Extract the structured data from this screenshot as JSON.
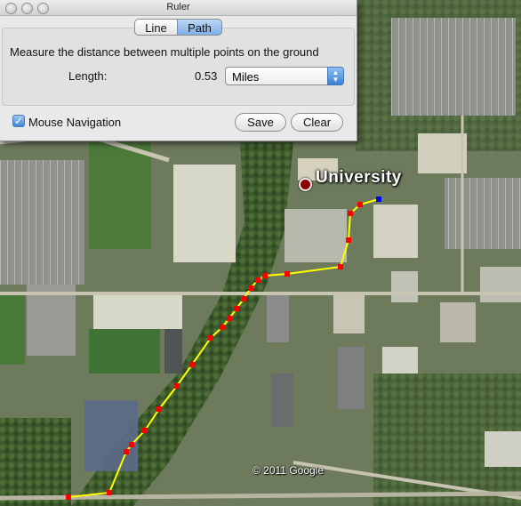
{
  "window": {
    "title": "Ruler"
  },
  "tabs": [
    {
      "label": "Line",
      "selected": false
    },
    {
      "label": "Path",
      "selected": true
    }
  ],
  "description": "Measure the distance between multiple points on the ground",
  "length": {
    "label": "Length:",
    "value": "0.53",
    "unit": "Miles"
  },
  "mouse_navigation": {
    "label": "Mouse Navigation",
    "checked": true
  },
  "buttons": {
    "save": "Save",
    "clear": "Clear"
  },
  "map": {
    "place_label": "University",
    "copyright": "© 2011 Google",
    "path_color": "#ffff00",
    "point_color": "#ff0000",
    "end_point_color": "#0000ff"
  }
}
